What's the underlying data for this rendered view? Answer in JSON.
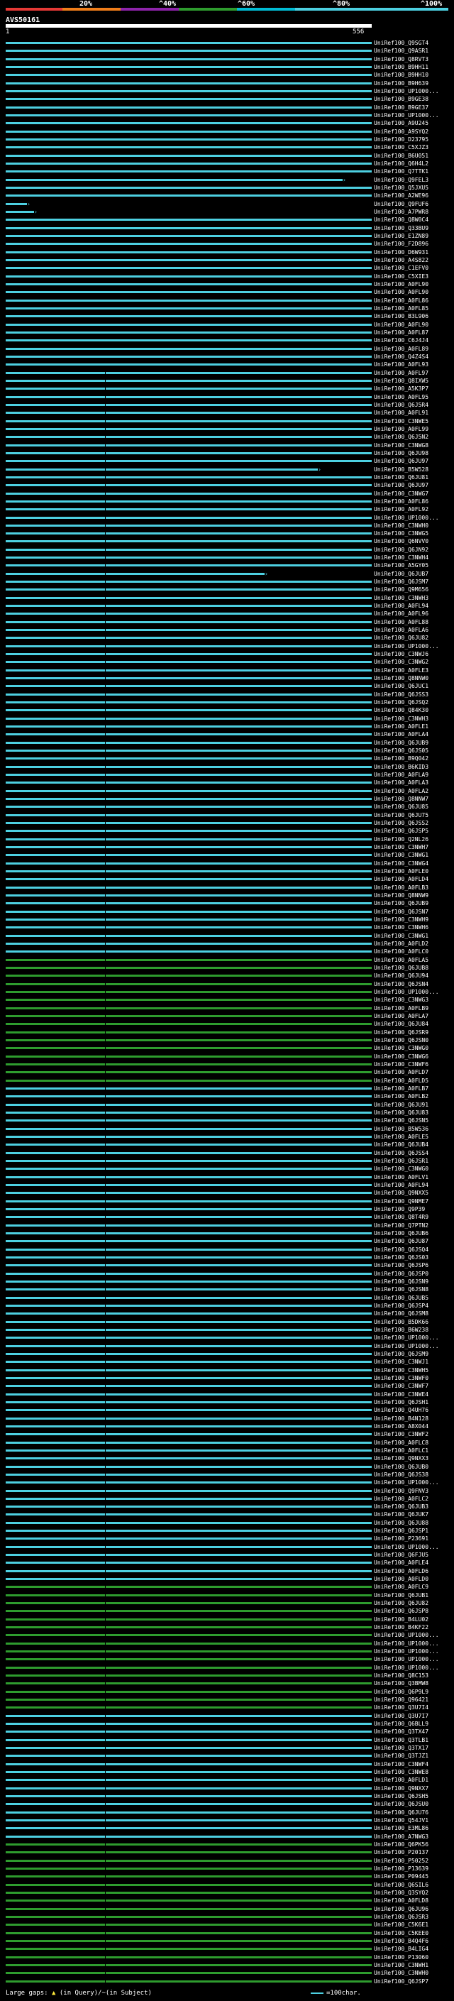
{
  "scale": {
    "labels": [
      "20%",
      "^40%",
      "^60%",
      "^80%",
      "^100%"
    ],
    "colors": [
      "#e53935",
      "#ef7d1a",
      "#8e24aa",
      "#2e9c2e",
      "#00bcd4",
      "#4dd0e1"
    ]
  },
  "query": {
    "title": "AVS50161",
    "start": "1",
    "end": "556"
  },
  "colors": {
    "cyan": "#4dd0e1",
    "green": "#2e9c2e"
  },
  "hits": [
    "UniRef100_Q9SGT4",
    "UniRef100_Q9ASR1",
    "UniRef100_Q8RVT3",
    "UniRef100_B9HH11",
    "UniRef100_B9HH10",
    "UniRef100_B9H639",
    "UniRef100_UP1000...",
    "UniRef100_B9GE38",
    "UniRef100_B9GE37",
    "UniRef100_UP1000...",
    "UniRef100_A9U245",
    "UniRef100_A9SYQ2",
    "UniRef100_D23795",
    "UniRef100_C5XJZ3",
    "UniRef100_B6U051",
    "UniRef100_Q6H4L2",
    "UniRef100_Q7TTK1",
    "UniRef100_Q9FEL3",
    "UniRef100_Q5JXU5",
    "UniRef100_A2WE96",
    "UniRef100_Q9FUF6",
    "UniRef100_A7PWR8",
    "UniRef100_Q8W0C4",
    "UniRef100_Q33BU9",
    "UniRef100_E1ZN89",
    "UniRef100_F2D896",
    "UniRef100_D6W931",
    "UniRef100_A4S822",
    "UniRef100_C1EFV0",
    "UniRef100_C5XIE3",
    "UniRef100_A0FL90",
    "UniRef100_A0FL90",
    "UniRef100_A0FL86",
    "UniRef100_A0FL85",
    "UniRef100_B3L906",
    "UniRef100_A0FL90",
    "UniRef100_A0FL87",
    "UniRef100_C6J4J4",
    "UniRef100_A0FL89",
    "UniRef100_Q4Z4S4",
    "UniRef100_A0FL93",
    "UniRef100_A0FL97",
    "UniRef100_Q8IXW5",
    "UniRef100_A5K3P7",
    "UniRef100_A0FL95",
    "UniRef100_Q6J5R4",
    "UniRef100_A0FL91",
    "UniRef100_C3NWE5",
    "UniRef100_A0FL99",
    "UniRef100_Q6J5N2",
    "UniRef100_C3NWG8",
    "UniRef100_Q6JU98",
    "UniRef100_Q6JU97",
    "UniRef100_B5W528",
    "UniRef100_Q6JU81",
    "UniRef100_Q6JU97",
    "UniRef100_C3NWG7",
    "UniRef100_A0FL86",
    "UniRef100_A0FL92",
    "UniRef100_UP1000...",
    "UniRef100_C3NWH0",
    "UniRef100_C3NWG5",
    "UniRef100_Q6NVV0",
    "UniRef100_Q6JN92",
    "UniRef100_C3NWH4",
    "UniRef100_A5GY05",
    "UniRef100_Q6JUB7",
    "UniRef100_Q6JSM7",
    "UniRef100_Q9M656",
    "UniRef100_C3NWH3",
    "UniRef100_A0FL94",
    "UniRef100_A0FL96",
    "UniRef100_A0FL88",
    "UniRef100_A0FLA6",
    "UniRef100_Q6JU82",
    "UniRef100_UP1000...",
    "UniRef100_C3NWJ6",
    "UniRef100_C3NWG2",
    "UniRef100_A0FLE3",
    "UniRef100_Q8NNW0",
    "UniRef100_Q6JUC1",
    "UniRef100_Q6JSS3",
    "UniRef100_Q6JSQ2",
    "UniRef100_Q84K30",
    "UniRef100_C3NWH3",
    "UniRef100_A0FLE1",
    "UniRef100_A0FLA4",
    "UniRef100_Q6JUB9",
    "UniRef100_Q6JS05",
    "UniRef100_B9Q042",
    "UniRef100_B6KID3",
    "UniRef100_A0FLA9",
    "UniRef100_A0FLA3",
    "UniRef100_A0FLA2",
    "UniRef100_Q8NNW7",
    "UniRef100_Q6JU85",
    "UniRef100_Q6JU75",
    "UniRef100_Q6JSS2",
    "UniRef100_Q6JSP5",
    "UniRef100_Q2NL26",
    "UniRef100_C3NWH7",
    "UniRef100_C3NWG1",
    "UniRef100_C3NWG4",
    "UniRef100_A0FLE0",
    "UniRef100_A0FLD4",
    "UniRef100_A0FLB3",
    "UniRef100_Q8NNW9",
    "UniRef100_Q6JUB9",
    "UniRef100_Q6JSN7",
    "UniRef100_C3NWH9",
    "UniRef100_C3NWH6",
    "UniRef100_C3NWG1",
    "UniRef100_A0FLD2",
    "UniRef100_A0FLC0",
    "UniRef100_A0FLA5",
    "UniRef100_Q6JUB8",
    "UniRef100_Q6JU94",
    "UniRef100_Q6JSN4",
    "UniRef100_UP1000...",
    "UniRef100_C3NWG3",
    "UniRef100_A0FLB9",
    "UniRef100_A0FLA7",
    "UniRef100_Q6JU84",
    "UniRef100_Q6JSR9",
    "UniRef100_Q6JSN0",
    "UniRef100_C3NWG0",
    "UniRef100_C3NWG6",
    "UniRef100_C3NWF6",
    "UniRef100_A0FLD7",
    "UniRef100_A0FLD5",
    "UniRef100_A0FLB7",
    "UniRef100_A0FLB2",
    "UniRef100_Q6JU91",
    "UniRef100_Q6JU83",
    "UniRef100_Q6JSN5",
    "UniRef100_B5W536",
    "UniRef100_A0FLE5",
    "UniRef100_Q6JUB4",
    "UniRef100_Q6JSS4",
    "UniRef100_Q6JSR1",
    "UniRef100_C3NWG0",
    "UniRef100_A0FLV1",
    "UniRef100_A0FL94",
    "UniRef100_Q9NXX5",
    "UniRef100_Q9NME7",
    "UniRef100_Q9P39",
    "UniRef100_Q8T4R9",
    "UniRef100_Q7PTN2",
    "UniRef100_Q6JUB6",
    "UniRef100_Q6JU87",
    "UniRef100_Q6JSQ4",
    "UniRef100_Q6JS03",
    "UniRef100_Q6JSP6",
    "UniRef100_Q6JSP0",
    "UniRef100_Q6JSN9",
    "UniRef100_Q6JSN8",
    "UniRef100_Q6JUB5",
    "UniRef100_Q6JSP4",
    "UniRef100_Q6JSM8",
    "UniRef100_B5DK66",
    "UniRef100_B6W238",
    "UniRef100_UP1000...",
    "UniRef100_UP1000...",
    "UniRef100_Q6JSM9",
    "UniRef100_C3NWJ1",
    "UniRef100_C3NWH5",
    "UniRef100_C3NWF0",
    "UniRef100_C3NWF7",
    "UniRef100_C3NWE4",
    "UniRef100_Q6JSH1",
    "UniRef100_Q4UH76",
    "UniRef100_B4N128",
    "UniRef100_A8X044",
    "UniRef100_C3NWF2",
    "UniRef100_A0FLC8",
    "UniRef100_A0FLC1",
    "UniRef100_Q9NXX3",
    "UniRef100_Q6JUB0",
    "UniRef100_Q6JS38",
    "UniRef100_UP1000...",
    "UniRef100_Q9FNV3",
    "UniRef100_A0FLC2",
    "UniRef100_Q6JUB3",
    "UniRef100_Q6JUK7",
    "UniRef100_Q6JU88",
    "UniRef100_Q6JSP1",
    "UniRef100_P23691",
    "UniRef100_UP1000...",
    "UniRef100_Q6FJU5",
    "UniRef100_A0FLE4",
    "UniRef100_A0FLD6",
    "UniRef100_A0FLD0",
    "UniRef100_A0FLC9",
    "UniRef100_Q6JUB1",
    "UniRef100_Q6JU82",
    "UniRef100_Q6JSP8",
    "UniRef100_B4LU02",
    "UniRef100_B4KF22",
    "UniRef100_UP1000...",
    "UniRef100_UP1000...",
    "UniRef100_UP1000...",
    "UniRef100_UP1000...",
    "UniRef100_UP1000...",
    "UniRef100_Q8C153",
    "UniRef100_Q3BMW8",
    "UniRef100_Q6P9L9",
    "UniRef100_Q96421",
    "UniRef100_Q3U7I4",
    "UniRef100_Q3U7I7",
    "UniRef100_Q6BLL9",
    "UniRef100_Q3TX47",
    "UniRef100_Q3TLB1",
    "UniRef100_Q3TX17",
    "UniRef100_Q3TJZ1",
    "UniRef100_C3NWF4",
    "UniRef100_C3NWE8",
    "UniRef100_A0FLD1",
    "UniRef100_Q9NXX7",
    "UniRef100_Q6JSH5",
    "UniRef100_Q6JSU0",
    "UniRef100_Q6JU76",
    "UniRef100_Q54JV1",
    "UniRef100_E3ML86",
    "UniRef100_A7NWG3",
    "UniRef100_Q6PK56",
    "UniRef100_P20137",
    "UniRef100_P50252",
    "UniRef100_P13639",
    "UniRef100_P09445",
    "UniRef100_Q6SIL6",
    "UniRef100_Q3SYQ2",
    "UniRef100_A0FLD8",
    "UniRef100_Q6JU96",
    "UniRef100_Q6JSR3",
    "UniRef100_C5K6E1",
    "UniRef100_C5KEE0",
    "UniRef100_B4Q4F6",
    "UniRef100_B4LIG4",
    "UniRef100_P13060",
    "UniRef100_C3NWH1",
    "UniRef100_C3NWH0",
    "UniRef100_Q6JSP7"
  ],
  "legend": {
    "gaps_label": "Large gaps:",
    "gaps_text": "(in Query)/~(in Subject)",
    "scale_text": "=100char."
  }
}
